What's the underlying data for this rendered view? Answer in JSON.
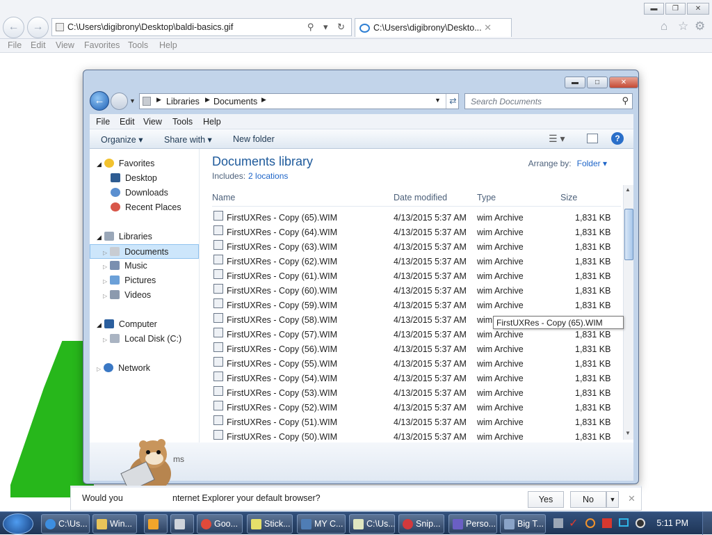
{
  "ie": {
    "address": "C:\\Users\\digibrony\\Desktop\\baldi-basics.gif",
    "tab_title": "C:\\Users\\digibrony\\Deskto...",
    "menu": [
      "File",
      "Edit",
      "View",
      "Favorites",
      "Tools",
      "Help"
    ]
  },
  "explorer": {
    "breadcrumb": [
      "Libraries",
      "Documents"
    ],
    "search_placeholder": "Search Documents",
    "menu": [
      "File",
      "Edit",
      "View",
      "Tools",
      "Help"
    ],
    "toolbar": {
      "organize": "Organize",
      "share_with": "Share with",
      "new_folder": "New folder"
    },
    "nav": {
      "favorites": {
        "label": "Favorites",
        "items": [
          "Desktop",
          "Downloads",
          "Recent Places"
        ]
      },
      "libraries": {
        "label": "Libraries",
        "items": [
          "Documents",
          "Music",
          "Pictures",
          "Videos"
        ],
        "selected": "Documents"
      },
      "computer": {
        "label": "Computer",
        "items": [
          "Local Disk (C:)"
        ]
      },
      "network": {
        "label": "Network"
      }
    },
    "library_title": "Documents library",
    "includes_label": "Includes:",
    "includes_link": "2 locations",
    "arrange_label": "Arrange by:",
    "arrange_value": "Folder",
    "columns": [
      "Name",
      "Date modified",
      "Type",
      "Size"
    ],
    "files": [
      {
        "name": "FirstUXRes - Copy (65).WIM",
        "date": "4/13/2015 5:37 AM",
        "type": "wim Archive",
        "size": "1,831 KB"
      },
      {
        "name": "FirstUXRes - Copy (64).WIM",
        "date": "4/13/2015 5:37 AM",
        "type": "wim Archive",
        "size": "1,831 KB"
      },
      {
        "name": "FirstUXRes - Copy (63).WIM",
        "date": "4/13/2015 5:37 AM",
        "type": "wim Archive",
        "size": "1,831 KB"
      },
      {
        "name": "FirstUXRes - Copy (62).WIM",
        "date": "4/13/2015 5:37 AM",
        "type": "wim Archive",
        "size": "1,831 KB"
      },
      {
        "name": "FirstUXRes - Copy (61).WIM",
        "date": "4/13/2015 5:37 AM",
        "type": "wim Archive",
        "size": "1,831 KB"
      },
      {
        "name": "FirstUXRes - Copy (60).WIM",
        "date": "4/13/2015 5:37 AM",
        "type": "wim Archive",
        "size": "1,831 KB"
      },
      {
        "name": "FirstUXRes - Copy (59).WIM",
        "date": "4/13/2015 5:37 AM",
        "type": "wim Archive",
        "size": "1,831 KB"
      },
      {
        "name": "FirstUXRes - Copy (58).WIM",
        "date": "4/13/2015 5:37 AM",
        "type": "wim Archive",
        "size": "1,831 KB"
      },
      {
        "name": "FirstUXRes - Copy (57).WIM",
        "date": "4/13/2015 5:37 AM",
        "type": "wim Archive",
        "size": "1,831 KB"
      },
      {
        "name": "FirstUXRes - Copy (56).WIM",
        "date": "4/13/2015 5:37 AM",
        "type": "wim Archive",
        "size": "1,831 KB"
      },
      {
        "name": "FirstUXRes - Copy (55).WIM",
        "date": "4/13/2015 5:37 AM",
        "type": "wim Archive",
        "size": "1,831 KB"
      },
      {
        "name": "FirstUXRes - Copy (54).WIM",
        "date": "4/13/2015 5:37 AM",
        "type": "wim Archive",
        "size": "1,831 KB"
      },
      {
        "name": "FirstUXRes - Copy (53).WIM",
        "date": "4/13/2015 5:37 AM",
        "type": "wim Archive",
        "size": "1,831 KB"
      },
      {
        "name": "FirstUXRes - Copy (52).WIM",
        "date": "4/13/2015 5:37 AM",
        "type": "wim Archive",
        "size": "1,831 KB"
      },
      {
        "name": "FirstUXRes - Copy (51).WIM",
        "date": "4/13/2015 5:37 AM",
        "type": "wim Archive",
        "size": "1,831 KB"
      },
      {
        "name": "FirstUXRes - Copy (50).WIM",
        "date": "4/13/2015 5:37 AM",
        "type": "wim Archive",
        "size": "1,831 KB"
      }
    ],
    "tooltip": "FirstUXRes - Copy (65).WIM",
    "details_text": "ms"
  },
  "notification": {
    "text_before": "Would you",
    "text_after": "nternet Explorer your default browser?",
    "yes": "Yes",
    "no": "No"
  },
  "taskbar": {
    "buttons": [
      "C:\\Us...",
      "Win...",
      "Goo...",
      "Stick...",
      "MY C...",
      "C:\\Us...",
      "Snip...",
      "Perso...",
      "Big T..."
    ],
    "clock": "5:11 PM"
  },
  "colors": {
    "library_title": "#1e5a9b",
    "link": "#1e65c8",
    "selection": "#cde6fb",
    "green_shape": "#27b71b",
    "taskbar": "#253f66"
  }
}
